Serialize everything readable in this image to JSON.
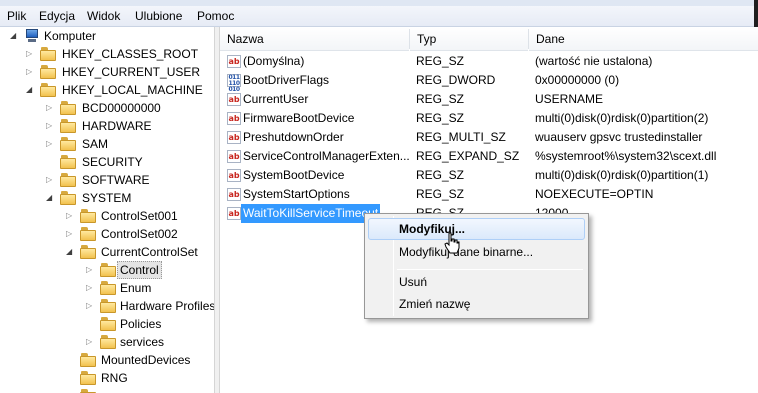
{
  "menu": [
    "Plik",
    "Edycja",
    "Widok",
    "Ulubione",
    "Pomoc"
  ],
  "tree": {
    "root": "Komputer",
    "items": [
      {
        "label": "HKEY_CLASSES_ROOT"
      },
      {
        "label": "HKEY_CURRENT_USER"
      },
      {
        "label": "HKEY_LOCAL_MACHINE"
      },
      {
        "label": "BCD00000000"
      },
      {
        "label": "HARDWARE"
      },
      {
        "label": "SAM"
      },
      {
        "label": "SECURITY"
      },
      {
        "label": "SOFTWARE"
      },
      {
        "label": "SYSTEM"
      },
      {
        "label": "ControlSet001"
      },
      {
        "label": "ControlSet002"
      },
      {
        "label": "CurrentControlSet"
      },
      {
        "label": "Control"
      },
      {
        "label": "Enum"
      },
      {
        "label": "Hardware Profiles"
      },
      {
        "label": "Policies"
      },
      {
        "label": "services"
      },
      {
        "label": "MountedDevices"
      },
      {
        "label": "RNG"
      }
    ]
  },
  "columns": {
    "name": "Nazwa",
    "type": "Typ",
    "data": "Dane"
  },
  "values": [
    {
      "name": "(Domyślna)",
      "type": "REG_SZ",
      "data": "(wartość nie ustalona)",
      "icon": "string-value-icon"
    },
    {
      "name": "BootDriverFlags",
      "type": "REG_DWORD",
      "data": "0x00000000 (0)",
      "icon": "binary-value-icon"
    },
    {
      "name": "CurrentUser",
      "type": "REG_SZ",
      "data": "USERNAME",
      "icon": "string-value-icon"
    },
    {
      "name": "FirmwareBootDevice",
      "type": "REG_SZ",
      "data": "multi(0)disk(0)rdisk(0)partition(2)",
      "icon": "string-value-icon"
    },
    {
      "name": "PreshutdownOrder",
      "type": "REG_MULTI_SZ",
      "data": "wuauserv gpsvc trustedinstaller",
      "icon": "string-value-icon"
    },
    {
      "name": "ServiceControlManagerExten...",
      "type": "REG_EXPAND_SZ",
      "data": "%systemroot%\\system32\\scext.dll",
      "icon": "string-value-icon"
    },
    {
      "name": "SystemBootDevice",
      "type": "REG_SZ",
      "data": "multi(0)disk(0)rdisk(0)partition(1)",
      "icon": "string-value-icon"
    },
    {
      "name": "SystemStartOptions",
      "type": "REG_SZ",
      "data": " NOEXECUTE=OPTIN",
      "icon": "string-value-icon"
    },
    {
      "name": "WaitToKillServiceTimeout",
      "type": "REG_SZ",
      "data": "12000",
      "icon": "string-value-icon"
    }
  ],
  "context_menu": {
    "modify": "Modyfikuj...",
    "modify_binary": "Modyfikuj dane binarne...",
    "delete": "Usuń",
    "rename": "Zmień nazwę"
  }
}
